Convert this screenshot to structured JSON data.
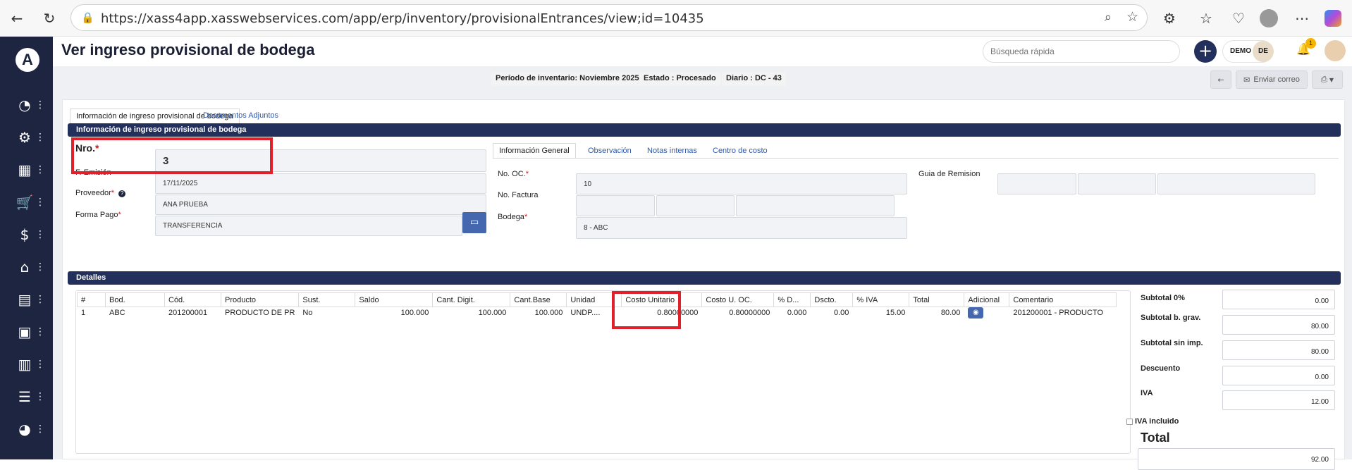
{
  "browser": {
    "url": "https://xass4app.xasswebservices.com/app/erp/inventory/provisionalEntrances/view;id=10435"
  },
  "header": {
    "title": "Ver ingreso provisional de bodega",
    "search_placeholder": "Búsqueda rápida",
    "add_label": "+",
    "user_label": "DEMO",
    "user_initials": "DE",
    "notification_count": "1"
  },
  "status": {
    "periodo": "Período de inventario: Noviembre 2025",
    "estado": "Estado : Procesado",
    "diario": "Diario : DC - 43"
  },
  "actions": {
    "back": "←",
    "email": "Enviar correo"
  },
  "tabs": {
    "main": [
      "Información de ingreso provisional de bodega",
      "Documentos Adjuntos"
    ],
    "sub": [
      "Información General",
      "Observación",
      "Notas internas",
      "Centro de costo"
    ]
  },
  "form": {
    "section_title": "Información de ingreso provisional de bodega",
    "nro_label": "Nro.",
    "nro_value": "3",
    "emision_label": "F. Emisión",
    "emision_value": "17/11/2025",
    "proveedor_label": "Proveedor",
    "proveedor_value": "ANA PRUEBA",
    "forma_pago_label": "Forma Pago",
    "forma_pago_value": "TRANSFERENCIA",
    "no_oc_label": "No. OC.",
    "no_oc_value": "10",
    "no_factura_label": "No. Factura",
    "bodega_label": "Bodega",
    "bodega_value": "8 - ABC",
    "guia_label": "Guia de Remision",
    "required_mark": "*"
  },
  "details": {
    "section_title": "Detalles",
    "columns": [
      "#",
      "Bod.",
      "Cód.",
      "Producto",
      "Sust.",
      "Saldo",
      "Cant. Digit.",
      "Cant.Base",
      "Unidad",
      "Costo Unitario",
      "Costo U. OC.",
      "% D...",
      "Dscto.",
      "% IVA",
      "Total",
      "Adicional",
      "Comentario"
    ],
    "rows": [
      [
        "1",
        "ABC",
        "201200001",
        "PRODUCTO DE PR",
        "No",
        "100.000",
        "100.000",
        "100.000",
        "UNDP....",
        "0.80000000",
        "0.80000000",
        "0.000",
        "0.00",
        "15.00",
        "80.00",
        "",
        "201200001 - PRODUCTO"
      ]
    ]
  },
  "totals": {
    "subtotal0_label": "Subtotal 0%",
    "subtotal0_value": "0.00",
    "subtotal_grav_label": "Subtotal b. grav.",
    "subtotal_grav_value": "80.00",
    "subtotal_sin_imp_label": "Subtotal sin imp.",
    "subtotal_sin_imp_value": "80.00",
    "descuento_label": "Descuento",
    "descuento_value": "0.00",
    "iva_label": "IVA",
    "iva_value": "12.00",
    "iva_incluido_label": "IVA incluido",
    "total_label": "Total",
    "total_value": "92.00"
  },
  "colors": {
    "sidebar": "#1d2540",
    "section_bar": "#23305c",
    "highlight": "#e0202a",
    "link": "#2f58a8"
  }
}
